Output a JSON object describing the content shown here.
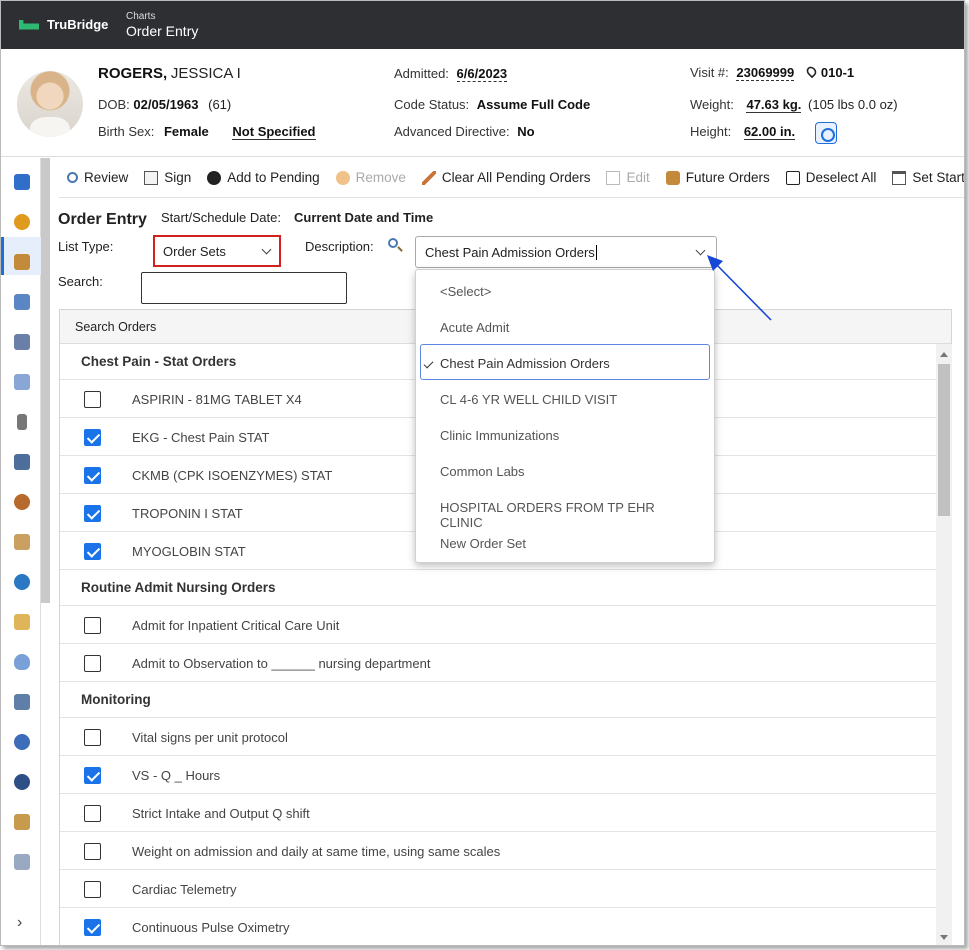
{
  "app": {
    "brand": "TruBridge",
    "breadcrumb_small": "Charts",
    "breadcrumb_title": "Order Entry"
  },
  "patient": {
    "last_name": "ROGERS,",
    "first_name": "JESSICA I",
    "dob_label": "DOB:",
    "dob": "02/05/1963",
    "age": "(61)",
    "sex_label": "Birth Sex:",
    "sex": "Female",
    "gender_identity": "Not Specified",
    "admitted_label": "Admitted:",
    "admitted": "6/6/2023",
    "code_label": "Code Status:",
    "code": "Assume Full Code",
    "directive_label": "Advanced Directive:",
    "directive": "No",
    "visit_label": "Visit #:",
    "visit": "23069999",
    "location": "010-1",
    "weight_label": "Weight:",
    "weight": "47.63 kg.",
    "weight_alt": "(105 lbs 0.0 oz)",
    "height_label": "Height:",
    "height": "62.00 in."
  },
  "toolbar": [
    {
      "label": "Review",
      "icon": "magnifier-icon",
      "disabled": false
    },
    {
      "label": "Sign",
      "icon": "sign-pen-icon",
      "disabled": false
    },
    {
      "label": "Add to Pending",
      "icon": "add-circle-icon",
      "disabled": false
    },
    {
      "label": "Remove",
      "icon": "remove-icon",
      "disabled": true
    },
    {
      "label": "Clear All Pending Orders",
      "icon": "eraser-icon",
      "disabled": false
    },
    {
      "label": "Edit",
      "icon": "edit-icon",
      "disabled": true
    },
    {
      "label": "Future Orders",
      "icon": "future-orders-icon",
      "disabled": false
    },
    {
      "label": "Deselect All",
      "icon": "checkbox-icon",
      "disabled": false
    },
    {
      "label": "Set Start/Sche",
      "icon": "calendar-icon",
      "disabled": false
    }
  ],
  "order_entry": {
    "title": "Order Entry",
    "start_label": "Start/Schedule Date:",
    "start_value": "Current Date and Time",
    "list_type_label": "List Type:",
    "list_type_value": "Order Sets",
    "description_label": "Description:",
    "description_value": "Chest Pain Admission Orders",
    "search_label": "Search:"
  },
  "search_panel": {
    "title": "Search Orders",
    "groups": [
      {
        "name": "Chest Pain - Stat Orders",
        "orders": [
          {
            "label": "ASPIRIN - 81MG TABLET X4",
            "checked": false
          },
          {
            "label": "EKG - Chest Pain STAT",
            "checked": true
          },
          {
            "label": "CKMB (CPK ISOENZYMES) STAT",
            "checked": true
          },
          {
            "label": "TROPONIN I STAT",
            "checked": true
          },
          {
            "label": "MYOGLOBIN STAT",
            "checked": true
          }
        ]
      },
      {
        "name": "Routine Admit Nursing Orders",
        "orders": [
          {
            "label": "Admit for Inpatient Critical Care Unit",
            "checked": false
          },
          {
            "label": "Admit to Observation to ______ nursing department",
            "checked": false
          }
        ]
      },
      {
        "name": "Monitoring",
        "orders": [
          {
            "label": "Vital signs per unit protocol",
            "checked": false
          },
          {
            "label": "VS - Q _ Hours",
            "checked": true
          },
          {
            "label": "Strict Intake and Output Q shift",
            "checked": false
          },
          {
            "label": "Weight on admission and daily at same time, using same scales",
            "checked": false
          },
          {
            "label": "Cardiac Telemetry",
            "checked": false
          },
          {
            "label": "Continuous Pulse Oximetry",
            "checked": true
          }
        ]
      }
    ]
  },
  "description_dropdown": {
    "options": [
      "<Select>",
      "Acute Admit",
      "Chest Pain Admission Orders",
      "CL 4-6 YR WELL CHILD VISIT",
      "Clinic Immunizations",
      "Common Labs",
      "HOSPITAL ORDERS FROM TP EHR CLINIC",
      "New Order Set"
    ],
    "selected_index": 2
  },
  "colors": {
    "topbar": "#2d2f33",
    "accent": "#1a73e8",
    "highlight_box": "#d0211c",
    "brand_green": "#2eb872"
  },
  "sidebar_icons": [
    "summary-icon",
    "alert-icon",
    "orders-icon",
    "chart-icon",
    "meds-icon",
    "documents-icon",
    "device-icon",
    "records-icon",
    "provider-icon",
    "staff-icon",
    "globe-icon",
    "first-aid-icon",
    "lab-flask-icon",
    "pharmacy-icon",
    "help-icon",
    "check-icon",
    "user-orders-icon",
    "notes-icon"
  ]
}
